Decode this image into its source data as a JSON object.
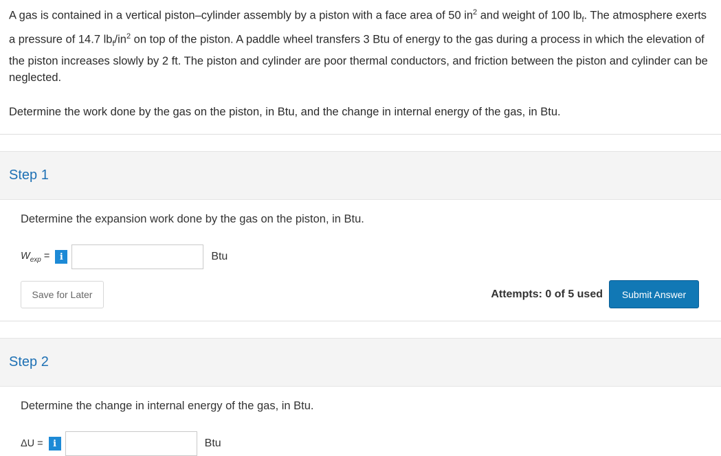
{
  "problem": {
    "paragraph": [
      {
        "t": "A gas is contained in a vertical piston–cylinder assembly by a piston with a face area of 50 in"
      },
      {
        "t": "2",
        "sup": true
      },
      {
        "t": " and weight of 100 lb"
      },
      {
        "t": "f",
        "sub": true
      },
      {
        "t": ". The atmosphere exerts a pressure of 14.7 lb"
      },
      {
        "t": "f",
        "sub": true
      },
      {
        "t": "/in"
      },
      {
        "t": "2",
        "sup": true
      },
      {
        "t": " on top of the piston. A paddle wheel transfers 3 Btu of energy to the gas during a process in which the elevation of the piston increases slowly by 2 ft. The piston and cylinder are poor thermal conductors, and friction between the piston and cylinder can be neglected."
      }
    ],
    "question": "Determine the work done by the gas on the piston, in Btu, and the change in internal energy of the gas, in Btu."
  },
  "step1": {
    "title": "Step 1",
    "question": "Determine the expansion work done by the gas on the piston, in Btu.",
    "var_main": "W",
    "var_sub": "exp",
    "equals": " =",
    "info": "i",
    "input_value": "",
    "unit": "Btu",
    "save_label": "Save for Later",
    "attempts": "Attempts: 0 of 5 used",
    "submit_label": "Submit Answer"
  },
  "step2": {
    "title": "Step 2",
    "question": "Determine the change in internal energy of the gas, in Btu.",
    "var_label": "ΔU =",
    "info": "i",
    "input_value": "",
    "unit": "Btu"
  },
  "colors": {
    "accent": "#1d70b4",
    "info_icon": "#1d8ad6",
    "submit_bg": "#1178b5",
    "step_header_bg": "#f4f4f4"
  }
}
